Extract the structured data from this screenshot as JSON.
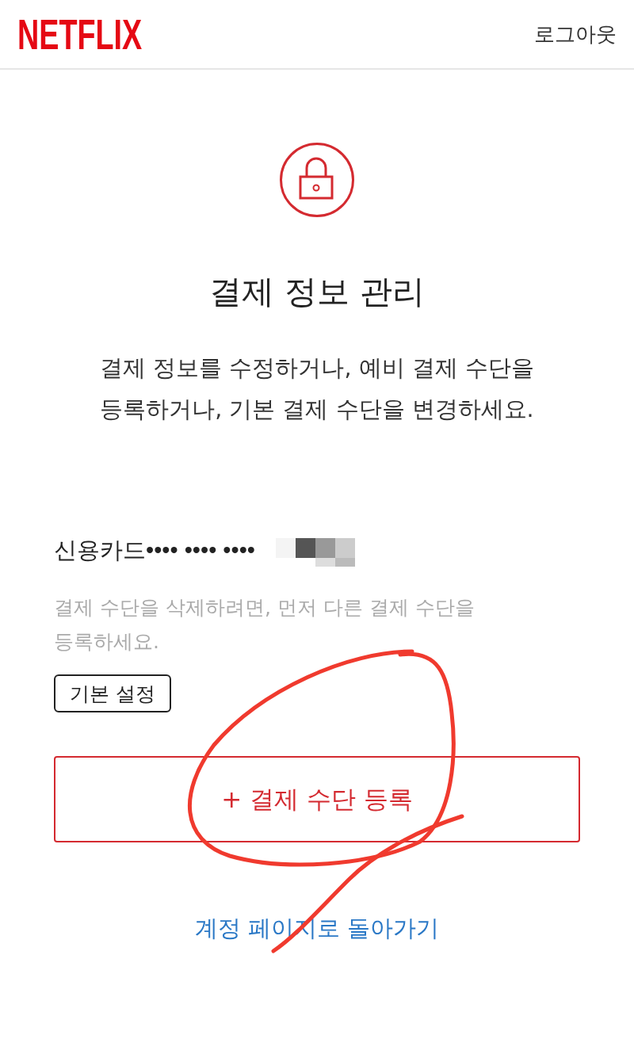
{
  "header": {
    "logo": "NETFLIX",
    "logout_link": "로그아웃"
  },
  "intro": {
    "title": "결제 정보 관리",
    "description": "결제 정보를 수정하거나, 예비 결제 수단을 등록하거나, 기본 결제 수단을 변경하세요."
  },
  "payment_methods": [
    {
      "label": "신용카드•••• •••• ••••",
      "hint": "결제 수단을 삭제하려면, 먼저 다른 결제 수단을 등록하세요.",
      "button": "기본 설정"
    }
  ],
  "add_button": "+ 결제 수단 등록",
  "back_link": "계정 페이지로 돌아가기"
}
